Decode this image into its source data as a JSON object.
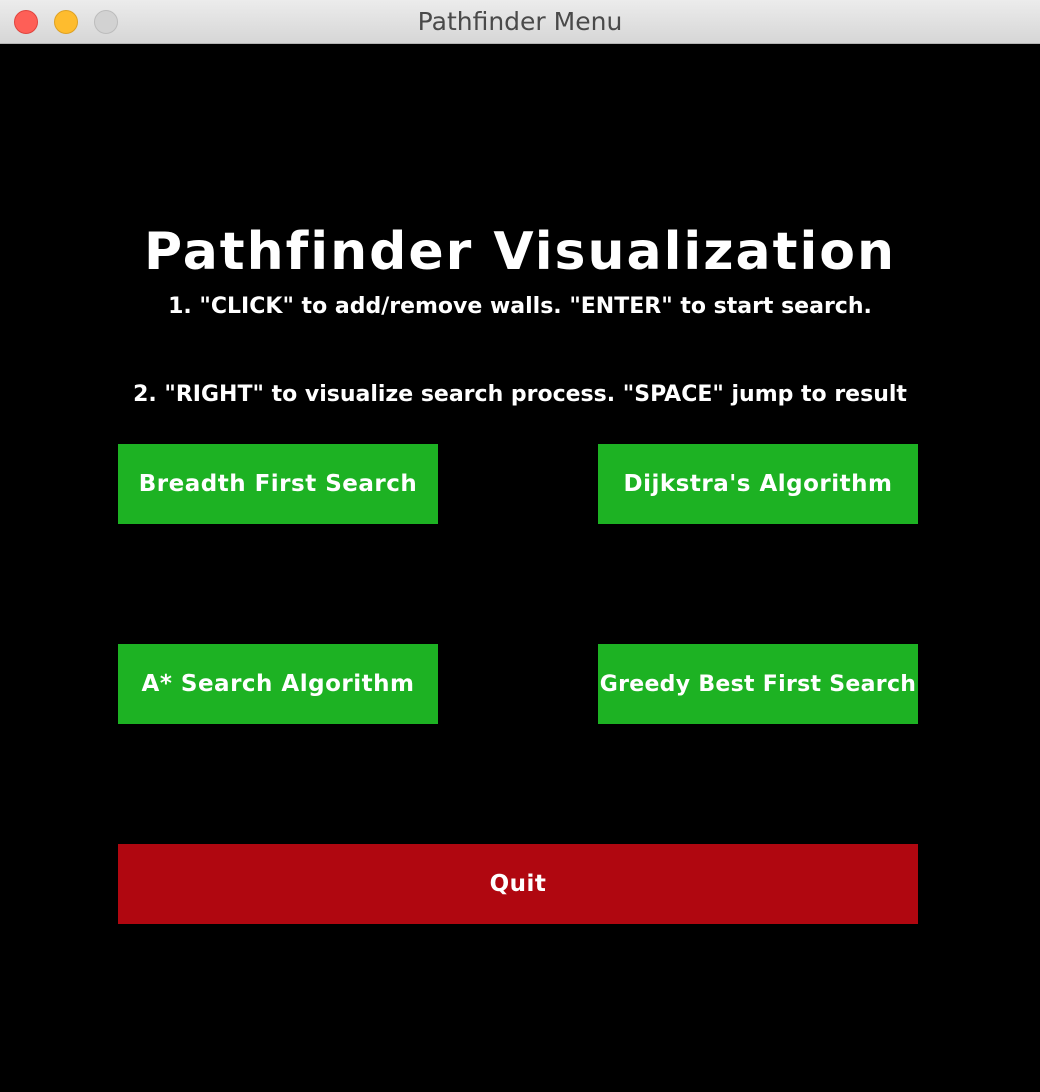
{
  "window": {
    "title": "Pathfinder Menu"
  },
  "colors": {
    "background": "#000000",
    "algorithm_button": "#1db223",
    "quit_button": "#b00710",
    "text": "#ffffff"
  },
  "menu": {
    "heading": "Pathfinder Visualization",
    "instructions": [
      "1. \"CLICK\" to add/remove walls. \"ENTER\" to start search.",
      "2. \"RIGHT\" to visualize search process. \"SPACE\" jump to result"
    ],
    "buttons": {
      "bfs": "Breadth First Search",
      "dijkstra": "Dijkstra's Algorithm",
      "astar": "A* Search Algorithm",
      "greedy": "Greedy Best First Search",
      "quit": "Quit"
    }
  }
}
